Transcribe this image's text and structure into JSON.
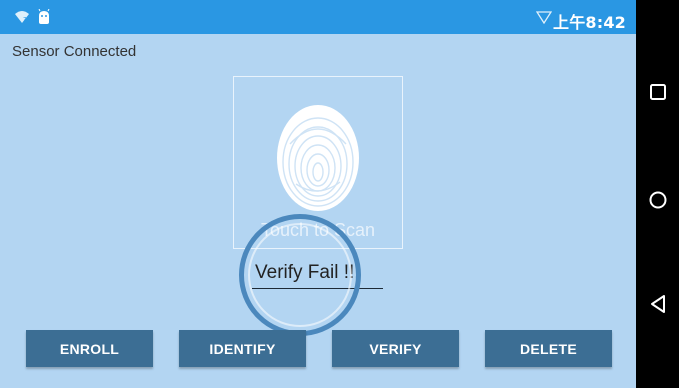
{
  "status_bar": {
    "time": "上午8:42",
    "icons": [
      "wifi-icon",
      "android-icon",
      "signal-icon"
    ],
    "color": "#2a97e3"
  },
  "app": {
    "sensor_status": "Sensor Connected",
    "scan_label": "Touch to Scan",
    "result_text": "Verify Fail !!!",
    "background": "#b3d5f2"
  },
  "buttons": {
    "enroll": "ENROLL",
    "identify": "IDENTIFY",
    "verify": "VERIFY",
    "delete": "DELETE",
    "color": "#3c6e94"
  },
  "nav_bar": {
    "icons": [
      "recents-square-icon",
      "home-circle-icon",
      "back-triangle-icon"
    ]
  }
}
